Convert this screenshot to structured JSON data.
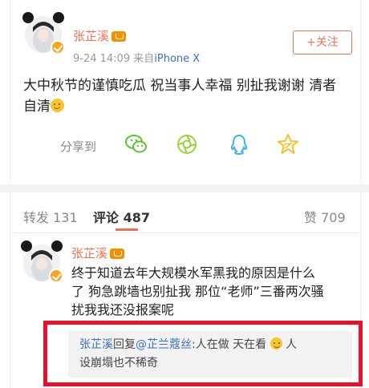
{
  "post": {
    "username": "张芷溪",
    "timestamp": "9-24 14:09",
    "source_prefix": "来自",
    "source_device": "iPhone X",
    "follow_label": "+关注",
    "text_line1": "大中秋节的谨慎吃瓜 祝当事人幸福 别扯我谢谢 清者",
    "text_line2": "自清",
    "share_label": "分享到",
    "share_targets": [
      "wechat-icon",
      "moments-icon",
      "qq-icon",
      "qzone-icon"
    ]
  },
  "tabs": {
    "repost_label": "转发",
    "repost_count": "131",
    "comment_label": "评论",
    "comment_count": "487",
    "like_label": "赞",
    "like_count": "709"
  },
  "comment": {
    "username": "张芷溪",
    "line1": "终于知道去年大规模水军黑我的原因是什么",
    "line2": "了 狗急跳墙也别扯我 那位“老师”三番两次骚",
    "line3": "扰我我还没报案呢",
    "reply": {
      "author": "张芷溪",
      "verb": "回复",
      "mention": "@芷兰蔻丝",
      "colon": ":",
      "text_line1": "人在做 天在看",
      "text_line1_tail": "人",
      "text_line2": "设崩塌也不稀奇"
    }
  },
  "colors": {
    "accent": "#eb7350",
    "link": "#3e6ebe",
    "highlight": "#e8102a",
    "verified": "#f5a623"
  }
}
